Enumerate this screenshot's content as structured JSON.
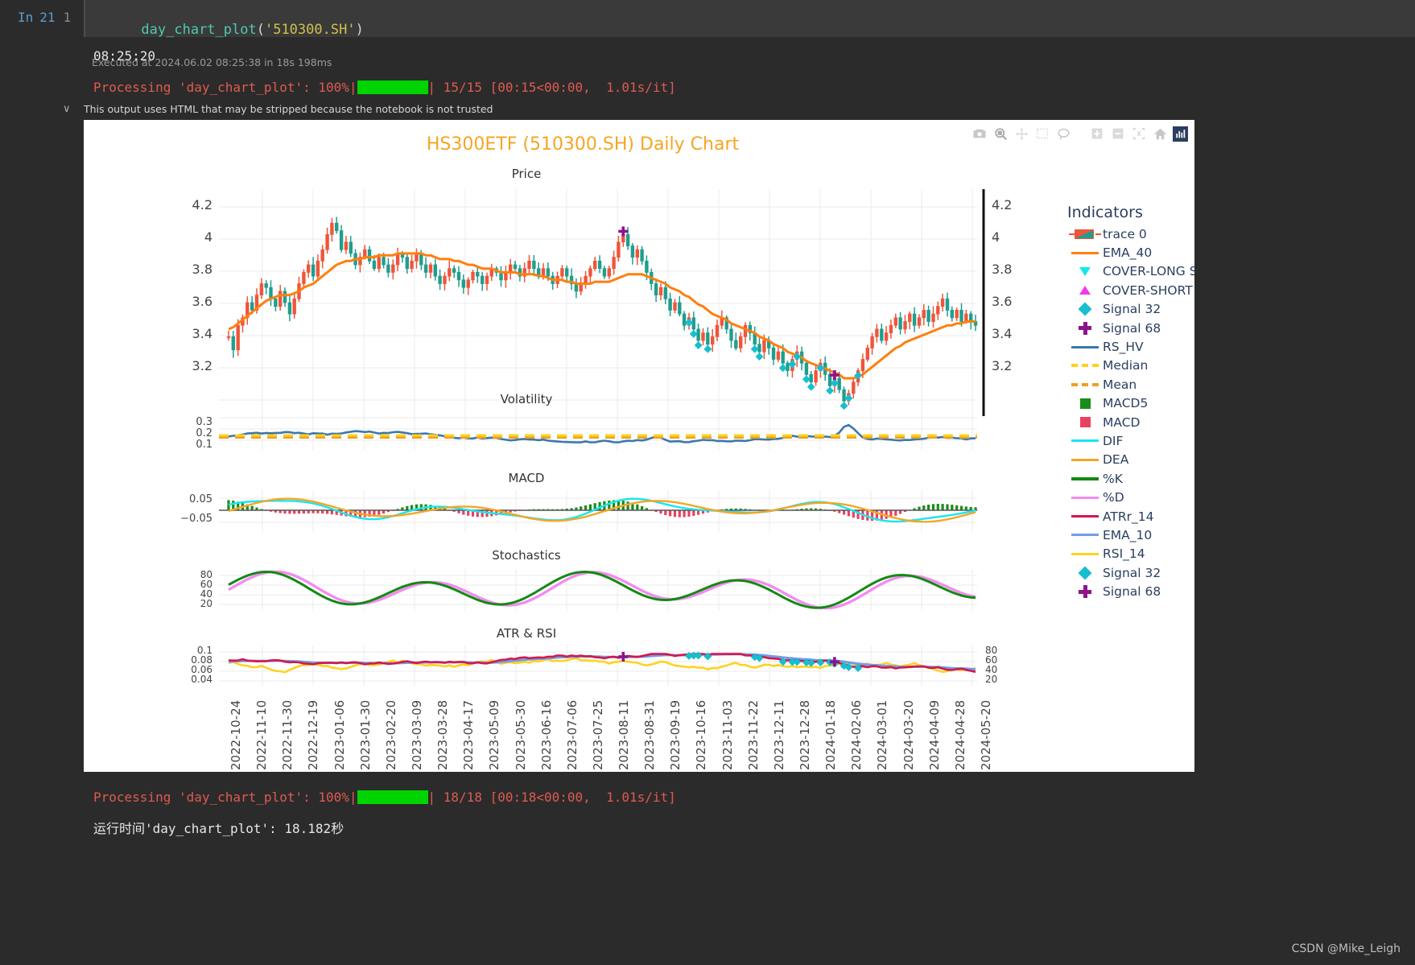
{
  "notebook": {
    "in_label": "In",
    "in_number": "21",
    "line_number": "1",
    "code_fn": "day_chart_plot",
    "code_open": "(",
    "code_arg": "'510300.SH'",
    "code_close": ")",
    "exec_info": "Executed at 2024.06.02 08:25:38 in 18s 198ms",
    "output_time": "08:25:20",
    "progress_prefix": "Processing 'day_chart_plot': 100%|",
    "progress_suffix": "| 15/15 [00:15<00:00,  1.01s/it]",
    "trust_chevron": "∨",
    "trust_message": "This output uses HTML that may be stripped because the notebook is not trusted",
    "footer_progress_prefix": "Processing 'day_chart_plot': 100%|",
    "footer_progress_suffix": "| 18/18 [00:18<00:00,  1.01s/it]",
    "footer_runtime": "运行时间'day_chart_plot': 18.182秒",
    "watermark": "CSDN @Mike_Leigh"
  },
  "modebar": {
    "buttons": [
      "camera-icon",
      "zoom-icon",
      "pan-icon",
      "box-select-icon",
      "lasso-select-icon",
      "zoom-in-icon",
      "zoom-out-icon",
      "autoscale-icon",
      "reset-axes-home-icon",
      "plotly-logo-icon"
    ]
  },
  "figure": {
    "title": "HS300ETF (510300.SH) Daily Chart",
    "title_color": "#f5a623",
    "panels": [
      {
        "name": "Price",
        "title": "Price"
      },
      {
        "name": "Volatility",
        "title": "Volatility"
      },
      {
        "name": "MACD",
        "title": "MACD"
      },
      {
        "name": "Stochastics",
        "title": "Stochastics"
      },
      {
        "name": "ATR & RSI",
        "title": "ATR & RSI"
      }
    ],
    "axes": {
      "price_left": [
        "4.2",
        "4",
        "3.8",
        "3.6",
        "3.4",
        "3.2"
      ],
      "price_right": [
        "4.2",
        "4",
        "3.8",
        "3.6",
        "3.4",
        "3.2"
      ],
      "volatility": [
        "0.3",
        "0.2",
        "0.1"
      ],
      "macd": [
        "0.05",
        "−0.05"
      ],
      "stochastics": [
        "80",
        "60",
        "40",
        "20"
      ],
      "atr_left": [
        "0.1",
        "0.08",
        "0.06",
        "0.04"
      ],
      "rsi_right": [
        "80",
        "60",
        "40",
        "20"
      ]
    },
    "xticks": [
      "2022-10-24",
      "2022-11-10",
      "2022-11-30",
      "2022-12-19",
      "2023-01-06",
      "2023-01-30",
      "2023-02-20",
      "2023-03-09",
      "2023-03-28",
      "2023-04-17",
      "2023-05-09",
      "2023-05-30",
      "2023-06-16",
      "2023-07-06",
      "2023-07-25",
      "2023-08-11",
      "2023-08-31",
      "2023-09-19",
      "2023-10-16",
      "2023-11-03",
      "2023-11-22",
      "2023-12-11",
      "2023-12-28",
      "2024-01-18",
      "2024-02-06",
      "2024-03-01",
      "2024-03-20",
      "2024-04-09",
      "2024-04-28",
      "2024-05-20"
    ]
  },
  "legend": {
    "title": "Indicators",
    "items": [
      {
        "label": "trace 0",
        "symbol": "candlestick",
        "color": "#ef553b",
        "color2": "#1f9e8e"
      },
      {
        "label": "EMA_40",
        "symbol": "line",
        "color": "#ff7f0e"
      },
      {
        "label": "COVER-LONG Signal",
        "symbol": "triangle-down",
        "color": "#12e8e8"
      },
      {
        "label": "COVER-SHORT Signal",
        "symbol": "triangle-up",
        "color": "#f038f0"
      },
      {
        "label": "Signal 32",
        "symbol": "diamond",
        "color": "#17becf"
      },
      {
        "label": "Signal 68",
        "symbol": "cross",
        "color": "#8e148e"
      },
      {
        "label": "RS_HV",
        "symbol": "line",
        "color": "#3b78b0"
      },
      {
        "label": "Median",
        "symbol": "dashed-line",
        "color": "#ffd21e"
      },
      {
        "label": "Mean",
        "symbol": "dashed-line",
        "color": "#f0a020"
      },
      {
        "label": "MACD5",
        "symbol": "square",
        "color": "#198c19"
      },
      {
        "label": "MACD",
        "symbol": "square",
        "color": "#e8415f"
      },
      {
        "label": "DIF",
        "symbol": "line",
        "color": "#19e6f0"
      },
      {
        "label": "DEA",
        "symbol": "line",
        "color": "#f5a623"
      },
      {
        "label": "%K",
        "symbol": "line-thick",
        "color": "#128a12"
      },
      {
        "label": "%D",
        "symbol": "line",
        "color": "#f28cf0"
      },
      {
        "label": "ATRr_14",
        "symbol": "line",
        "color": "#d6174b"
      },
      {
        "label": "EMA_10",
        "symbol": "line",
        "color": "#6e9ee8"
      },
      {
        "label": "RSI_14",
        "symbol": "line",
        "color": "#ffd21e"
      },
      {
        "label": "Signal 32",
        "symbol": "diamond",
        "color": "#17becf"
      },
      {
        "label": "Signal 68",
        "symbol": "cross",
        "color": "#8e148e"
      }
    ]
  },
  "chart_data": {
    "type": "line",
    "title": "HS300ETF (510300.SH) Daily Chart",
    "xlabel": "",
    "ylabel": "Price",
    "subplots": [
      {
        "name": "Price",
        "ylim": [
          3.1,
          4.3
        ],
        "yticks": [
          3.2,
          3.4,
          3.6,
          3.8,
          4.0,
          4.2
        ],
        "series": [
          {
            "name": "trace 0",
            "type": "candlestick",
            "up_color": "#ef553b",
            "down_color": "#1f9e8e",
            "close": [
              3.52,
              3.45,
              3.58,
              3.62,
              3.7,
              3.66,
              3.74,
              3.8,
              3.78,
              3.72,
              3.68,
              3.76,
              3.7,
              3.64,
              3.72,
              3.8,
              3.86,
              3.9,
              3.84,
              3.92,
              3.98,
              4.06,
              4.12,
              4.08,
              3.98,
              4.02,
              3.96,
              3.9,
              3.94,
              3.98,
              3.92,
              3.88,
              3.94,
              3.9,
              3.86,
              3.9,
              3.96,
              3.94,
              3.88,
              3.92,
              3.96,
              3.9,
              3.86,
              3.9,
              3.84,
              3.8,
              3.84,
              3.88,
              3.86,
              3.82,
              3.78,
              3.82,
              3.86,
              3.84,
              3.8,
              3.84,
              3.88,
              3.86,
              3.82,
              3.86,
              3.9,
              3.88,
              3.84,
              3.88,
              3.92,
              3.88,
              3.84,
              3.88,
              3.84,
              3.8,
              3.84,
              3.88,
              3.84,
              3.8,
              3.76,
              3.8,
              3.84,
              3.88,
              3.92,
              3.88,
              3.84,
              3.88,
              3.94,
              4.02,
              4.06,
              4.0,
              3.94,
              3.98,
              3.92,
              3.86,
              3.8,
              3.74,
              3.78,
              3.72,
              3.66,
              3.7,
              3.64,
              3.58,
              3.62,
              3.56,
              3.5,
              3.54,
              3.48,
              3.52,
              3.58,
              3.62,
              3.56,
              3.5,
              3.46,
              3.52,
              3.58,
              3.54,
              3.48,
              3.44,
              3.5,
              3.46,
              3.4,
              3.44,
              3.38,
              3.34,
              3.4,
              3.44,
              3.38,
              3.32,
              3.28,
              3.34,
              3.38,
              3.32,
              3.26,
              3.3,
              3.24,
              3.18,
              3.22,
              3.28,
              3.34,
              3.4,
              3.46,
              3.52,
              3.56,
              3.5,
              3.54,
              3.58,
              3.62,
              3.56,
              3.6,
              3.64,
              3.58,
              3.62,
              3.66,
              3.6,
              3.64,
              3.68,
              3.72,
              3.66,
              3.62,
              3.66,
              3.6,
              3.64,
              3.6,
              3.58
            ]
          },
          {
            "name": "EMA_40",
            "type": "line",
            "color": "#ff7f0e",
            "values": [
              3.56,
              3.57,
              3.59,
              3.61,
              3.63,
              3.65,
              3.67,
              3.69,
              3.71,
              3.72,
              3.73,
              3.74,
              3.74,
              3.74,
              3.75,
              3.76,
              3.78,
              3.79,
              3.8,
              3.82,
              3.84,
              3.86,
              3.88,
              3.9,
              3.91,
              3.92,
              3.92,
              3.93,
              3.93,
              3.94,
              3.94,
              3.94,
              3.95,
              3.95,
              3.95,
              3.95,
              3.96,
              3.96,
              3.96,
              3.96,
              3.96,
              3.96,
              3.95,
              3.95,
              3.94,
              3.93,
              3.93,
              3.93,
              3.92,
              3.92,
              3.91,
              3.9,
              3.9,
              3.89,
              3.88,
              3.88,
              3.88,
              3.87,
              3.86,
              3.86,
              3.86,
              3.86,
              3.85,
              3.85,
              3.85,
              3.85,
              3.84,
              3.84,
              3.83,
              3.82,
              3.82,
              3.82,
              3.81,
              3.81,
              3.8,
              3.8,
              3.8,
              3.8,
              3.81,
              3.81,
              3.81,
              3.81,
              3.82,
              3.83,
              3.84,
              3.85,
              3.85,
              3.85,
              3.85,
              3.84,
              3.83,
              3.82,
              3.81,
              3.8,
              3.78,
              3.77,
              3.76,
              3.74,
              3.73,
              3.71,
              3.69,
              3.68,
              3.66,
              3.64,
              3.63,
              3.62,
              3.61,
              3.59,
              3.58,
              3.57,
              3.56,
              3.55,
              3.54,
              3.52,
              3.51,
              3.5,
              3.48,
              3.47,
              3.46,
              3.44,
              3.43,
              3.42,
              3.41,
              3.39,
              3.38,
              3.37,
              3.36,
              3.35,
              3.34,
              3.33,
              3.32,
              3.3,
              3.3,
              3.3,
              3.31,
              3.32,
              3.34,
              3.36,
              3.38,
              3.4,
              3.42,
              3.44,
              3.46,
              3.47,
              3.49,
              3.5,
              3.51,
              3.52,
              3.53,
              3.54,
              3.55,
              3.56,
              3.57,
              3.58,
              3.58,
              3.59,
              3.59,
              3.6,
              3.6,
              3.6
            ]
          }
        ]
      },
      {
        "name": "Volatility",
        "ylim": [
          0.05,
          0.33
        ],
        "yticks": [
          0.1,
          0.2,
          0.3
        ],
        "series": [
          {
            "name": "RS_HV",
            "type": "line",
            "color": "#3b78b0"
          },
          {
            "name": "Median",
            "type": "dashed",
            "color": "#ffd21e",
            "value": 0.135
          },
          {
            "name": "Mean",
            "type": "dashed",
            "color": "#f0a020",
            "value": 0.14
          }
        ]
      },
      {
        "name": "MACD",
        "ylim": [
          -0.09,
          0.09
        ],
        "yticks": [
          -0.05,
          0.05
        ],
        "series": [
          {
            "name": "MACD5",
            "type": "bar",
            "color": "#198c19"
          },
          {
            "name": "MACD",
            "type": "bar",
            "color": "#e8415f"
          },
          {
            "name": "DIF",
            "type": "line",
            "color": "#19e6f0"
          },
          {
            "name": "DEA",
            "type": "line",
            "color": "#f5a623"
          }
        ]
      },
      {
        "name": "Stochastics",
        "ylim": [
          0,
          100
        ],
        "yticks": [
          20,
          40,
          60,
          80
        ],
        "series": [
          {
            "name": "%K",
            "type": "line",
            "color": "#128a12"
          },
          {
            "name": "%D",
            "type": "line",
            "color": "#f28cf0"
          }
        ]
      },
      {
        "name": "ATR & RSI",
        "ylim_left": [
          0.03,
          0.11
        ],
        "yticks_left": [
          0.04,
          0.06,
          0.08,
          0.1
        ],
        "ylim_right": [
          10,
          90
        ],
        "yticks_right": [
          20,
          40,
          60,
          80
        ],
        "series": [
          {
            "name": "ATRr_14",
            "type": "line",
            "color": "#d6174b"
          },
          {
            "name": "EMA_10",
            "type": "line",
            "color": "#6e9ee8"
          },
          {
            "name": "RSI_14",
            "type": "line",
            "color": "#ffd21e"
          }
        ]
      }
    ]
  }
}
